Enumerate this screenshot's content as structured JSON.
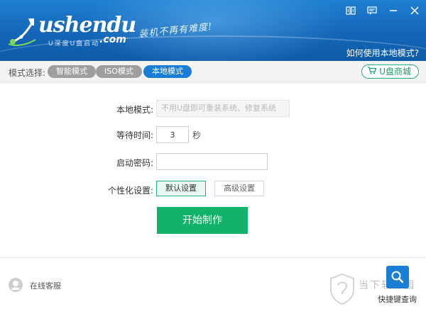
{
  "header": {
    "logo_text": "ushendu",
    "logo_com": ".com",
    "logo_sub": "U深度U盘启动",
    "slogan": "装机不再有难度!",
    "help_link": "如何使用本地模式?"
  },
  "modebar": {
    "label": "模式选择:",
    "tabs": [
      {
        "label": "智能模式",
        "active": false
      },
      {
        "label": "ISO模式",
        "active": false
      },
      {
        "label": "本地模式",
        "active": true
      }
    ],
    "shop_label": "U盘商城"
  },
  "form": {
    "local_mode_label": "本地模式:",
    "local_mode_placeholder": "不用U盘即可重装系统、修复系统",
    "wait_label": "等待时间:",
    "wait_value": "3",
    "wait_unit": "秒",
    "password_label": "启动密码:",
    "password_value": "",
    "custom_label": "个性化设置:",
    "default_btn": "默认设置",
    "advanced_btn": "高级设置",
    "start_btn": "开始制作"
  },
  "footer": {
    "service_label": "在线客服",
    "quick_label": "快捷键查询",
    "watermark": "当下软件园"
  },
  "colors": {
    "header_blue": "#1466b8",
    "accent_blue": "#1a7fd4",
    "green": "#13b26a"
  }
}
